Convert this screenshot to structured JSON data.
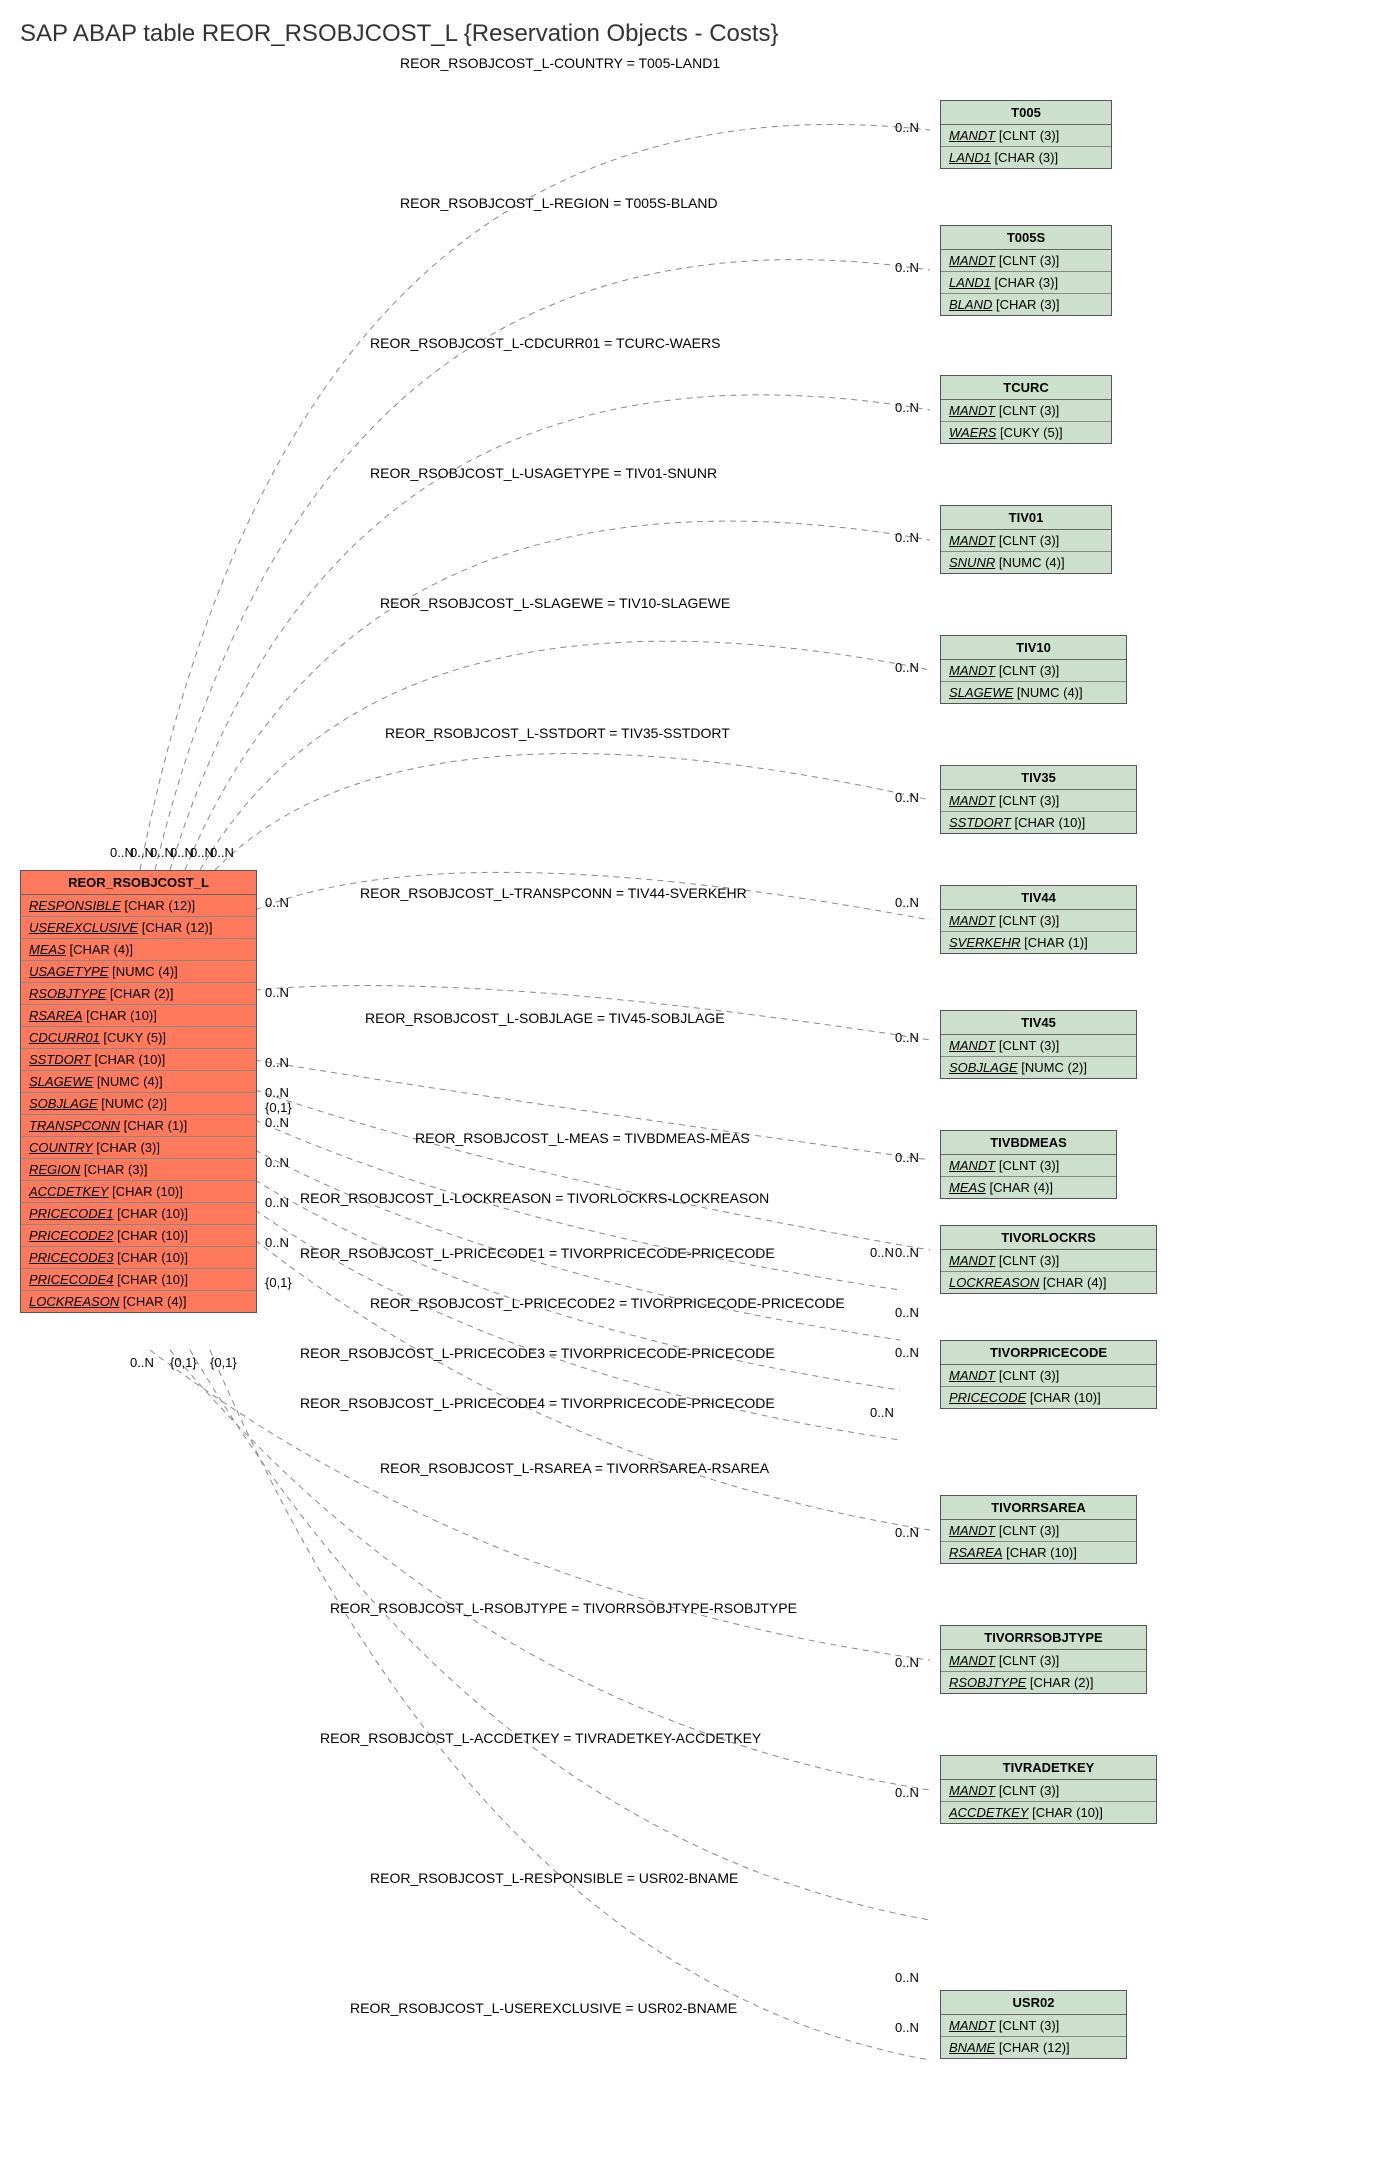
{
  "title": "SAP ABAP table REOR_RSOBJCOST_L {Reservation Objects - Costs}",
  "source_entity": {
    "name": "REOR_RSOBJCOST_L",
    "fields": [
      {
        "n": "RESPONSIBLE",
        "t": "[CHAR (12)]"
      },
      {
        "n": "USEREXCLUSIVE",
        "t": "[CHAR (12)]"
      },
      {
        "n": "MEAS",
        "t": "[CHAR (4)]"
      },
      {
        "n": "USAGETYPE",
        "t": "[NUMC (4)]"
      },
      {
        "n": "RSOBJTYPE",
        "t": "[CHAR (2)]"
      },
      {
        "n": "RSAREA",
        "t": "[CHAR (10)]"
      },
      {
        "n": "CDCURR01",
        "t": "[CUKY (5)]"
      },
      {
        "n": "SSTDORT",
        "t": "[CHAR (10)]"
      },
      {
        "n": "SLAGEWE",
        "t": "[NUMC (4)]"
      },
      {
        "n": "SOBJLAGE",
        "t": "[NUMC (2)]"
      },
      {
        "n": "TRANSPCONN",
        "t": "[CHAR (1)]"
      },
      {
        "n": "COUNTRY",
        "t": "[CHAR (3)]"
      },
      {
        "n": "REGION",
        "t": "[CHAR (3)]"
      },
      {
        "n": "ACCDETKEY",
        "t": "[CHAR (10)]"
      },
      {
        "n": "PRICECODE1",
        "t": "[CHAR (10)]"
      },
      {
        "n": "PRICECODE2",
        "t": "[CHAR (10)]"
      },
      {
        "n": "PRICECODE3",
        "t": "[CHAR (10)]"
      },
      {
        "n": "PRICECODE4",
        "t": "[CHAR (10)]"
      },
      {
        "n": "LOCKREASON",
        "t": "[CHAR (4)]"
      }
    ]
  },
  "targets": [
    {
      "name": "T005",
      "fields": [
        {
          "n": "MANDT",
          "t": "[CLNT (3)]"
        },
        {
          "n": "LAND1",
          "t": "[CHAR (3)]"
        }
      ]
    },
    {
      "name": "T005S",
      "fields": [
        {
          "n": "MANDT",
          "t": "[CLNT (3)]"
        },
        {
          "n": "LAND1",
          "t": "[CHAR (3)]"
        },
        {
          "n": "BLAND",
          "t": "[CHAR (3)]"
        }
      ]
    },
    {
      "name": "TCURC",
      "fields": [
        {
          "n": "MANDT",
          "t": "[CLNT (3)]"
        },
        {
          "n": "WAERS",
          "t": "[CUKY (5)]"
        }
      ]
    },
    {
      "name": "TIV01",
      "fields": [
        {
          "n": "MANDT",
          "t": "[CLNT (3)]"
        },
        {
          "n": "SNUNR",
          "t": "[NUMC (4)]"
        }
      ]
    },
    {
      "name": "TIV10",
      "fields": [
        {
          "n": "MANDT",
          "t": "[CLNT (3)]"
        },
        {
          "n": "SLAGEWE",
          "t": "[NUMC (4)]"
        }
      ]
    },
    {
      "name": "TIV35",
      "fields": [
        {
          "n": "MANDT",
          "t": "[CLNT (3)]"
        },
        {
          "n": "SSTDORT",
          "t": "[CHAR (10)]"
        }
      ]
    },
    {
      "name": "TIV44",
      "fields": [
        {
          "n": "MANDT",
          "t": "[CLNT (3)]"
        },
        {
          "n": "SVERKEHR",
          "t": "[CHAR (1)]"
        }
      ]
    },
    {
      "name": "TIV45",
      "fields": [
        {
          "n": "MANDT",
          "t": "[CLNT (3)]"
        },
        {
          "n": "SOBJLAGE",
          "t": "[NUMC (2)]"
        }
      ]
    },
    {
      "name": "TIVBDMEAS",
      "fields": [
        {
          "n": "MANDT",
          "t": "[CLNT (3)]"
        },
        {
          "n": "MEAS",
          "t": "[CHAR (4)]"
        }
      ]
    },
    {
      "name": "TIVORLOCKRS",
      "fields": [
        {
          "n": "MANDT",
          "t": "[CLNT (3)]"
        },
        {
          "n": "LOCKREASON",
          "t": "[CHAR (4)]"
        }
      ]
    },
    {
      "name": "TIVORPRICECODE",
      "fields": [
        {
          "n": "MANDT",
          "t": "[CLNT (3)]"
        },
        {
          "n": "PRICECODE",
          "t": "[CHAR (10)]"
        }
      ]
    },
    {
      "name": "TIVORRSAREA",
      "fields": [
        {
          "n": "MANDT",
          "t": "[CLNT (3)]"
        },
        {
          "n": "RSAREA",
          "t": "[CHAR (10)]"
        }
      ]
    },
    {
      "name": "TIVORRSOBJTYPE",
      "fields": [
        {
          "n": "MANDT",
          "t": "[CLNT (3)]"
        },
        {
          "n": "RSOBJTYPE",
          "t": "[CHAR (2)]"
        }
      ]
    },
    {
      "name": "TIVRADETKEY",
      "fields": [
        {
          "n": "MANDT",
          "t": "[CLNT (3)]"
        },
        {
          "n": "ACCDETKEY",
          "t": "[CHAR (10)]"
        }
      ]
    },
    {
      "name": "USR02",
      "fields": [
        {
          "n": "MANDT",
          "t": "[CLNT (3)]"
        },
        {
          "n": "BNAME",
          "t": "[CHAR (12)]"
        }
      ]
    }
  ],
  "relations": [
    {
      "label": "REOR_RSOBJCOST_L-COUNTRY = T005-LAND1",
      "card_right": "0..N"
    },
    {
      "label": "REOR_RSOBJCOST_L-REGION = T005S-BLAND",
      "card_right": "0..N"
    },
    {
      "label": "REOR_RSOBJCOST_L-CDCURR01 = TCURC-WAERS",
      "card_right": "0..N"
    },
    {
      "label": "REOR_RSOBJCOST_L-USAGETYPE = TIV01-SNUNR",
      "card_right": "0..N"
    },
    {
      "label": "REOR_RSOBJCOST_L-SLAGEWE = TIV10-SLAGEWE",
      "card_right": "0..N"
    },
    {
      "label": "REOR_RSOBJCOST_L-SSTDORT = TIV35-SSTDORT",
      "card_right": "0..N"
    },
    {
      "label": "REOR_RSOBJCOST_L-TRANSPCONN = TIV44-SVERKEHR",
      "card_right": "0..N"
    },
    {
      "label": "REOR_RSOBJCOST_L-SOBJLAGE = TIV45-SOBJLAGE",
      "card_right": "0..N"
    },
    {
      "label": "REOR_RSOBJCOST_L-MEAS = TIVBDMEAS-MEAS",
      "card_right": "0..N"
    },
    {
      "label": "REOR_RSOBJCOST_L-LOCKREASON = TIVORLOCKRS-LOCKREASON",
      "card_right": "0..N"
    },
    {
      "label": "REOR_RSOBJCOST_L-PRICECODE1 = TIVORPRICECODE-PRICECODE",
      "card_right": "0..N"
    },
    {
      "label": "REOR_RSOBJCOST_L-PRICECODE2 = TIVORPRICECODE-PRICECODE",
      "card_right": "0..N"
    },
    {
      "label": "REOR_RSOBJCOST_L-PRICECODE3 = TIVORPRICECODE-PRICECODE",
      "card_right": "0..N"
    },
    {
      "label": "REOR_RSOBJCOST_L-PRICECODE4 = TIVORPRICECODE-PRICECODE",
      "card_right": "0..N"
    },
    {
      "label": "REOR_RSOBJCOST_L-RSAREA = TIVORRSAREA-RSAREA",
      "card_right": "0..N"
    },
    {
      "label": "REOR_RSOBJCOST_L-RSOBJTYPE = TIVORRSOBJTYPE-RSOBJTYPE",
      "card_right": "0..N"
    },
    {
      "label": "REOR_RSOBJCOST_L-ACCDETKEY = TIVRADETKEY-ACCDETKEY",
      "card_right": "0..N"
    },
    {
      "label": "REOR_RSOBJCOST_L-RESPONSIBLE = USR02-BNAME",
      "card_right": "0..N"
    },
    {
      "label": "REOR_RSOBJCOST_L-USEREXCLUSIVE = USR02-BNAME",
      "card_right": "0..N"
    }
  ],
  "left_cards": [
    "0..N",
    "0..N",
    "0..N",
    "0..N",
    "0..N",
    "0..N",
    "0..N",
    "0..N",
    "0..N",
    "0..N",
    "{0,1}",
    "0..N",
    "0..N",
    "0..N",
    "0..N",
    "{0,1}",
    "0..N",
    "{0,1}",
    "{0,1}"
  ],
  "bottom_cards": [
    "0..N",
    "{0,1}",
    "{0,1}"
  ]
}
